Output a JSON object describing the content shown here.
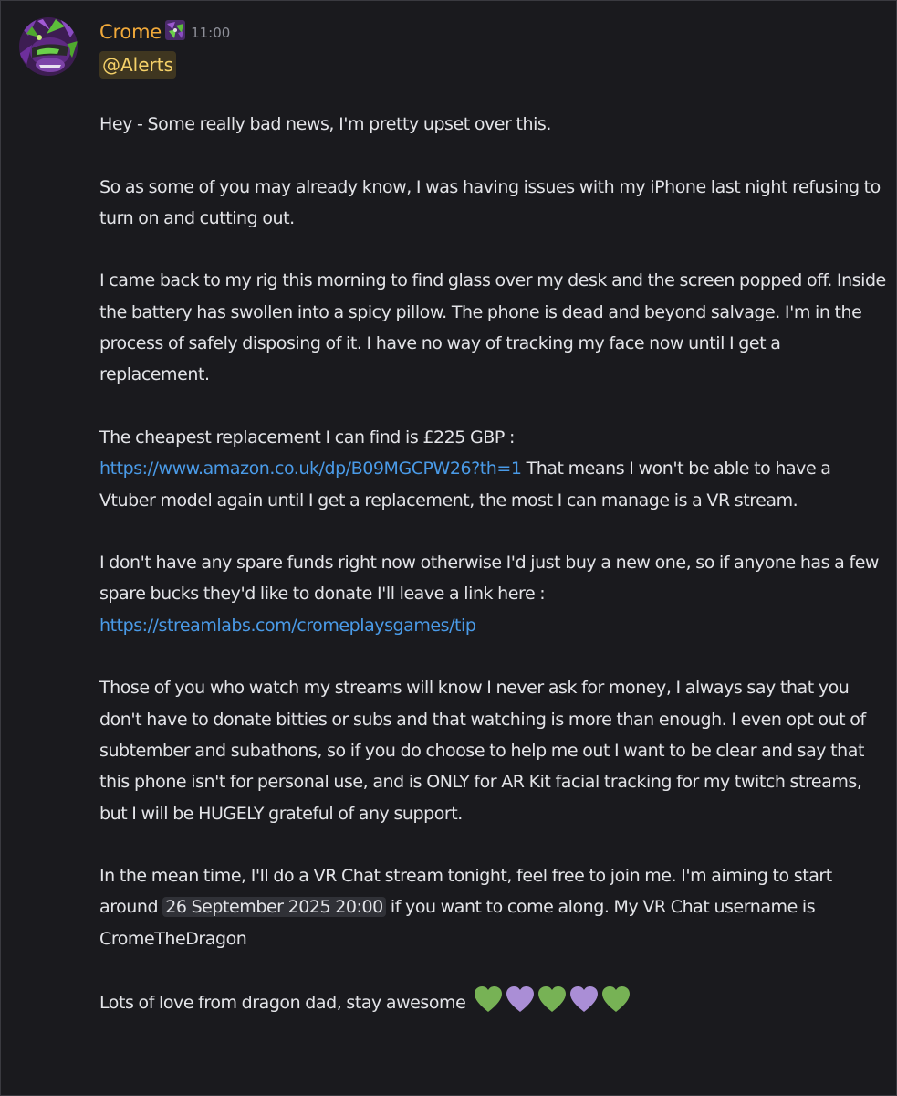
{
  "message": {
    "author": "Crome",
    "timestamp": "11:00",
    "mention": "@Alerts",
    "paragraphs": {
      "p1": "Hey - Some really bad news, I'm pretty upset over this.",
      "p2": "So as some of you may already know, I was having issues with my iPhone last night refusing to turn on and cutting out.",
      "p3": "I came back to my rig this morning to find glass over my desk and the screen popped off. Inside the battery has swollen into a spicy pillow. The phone is dead and beyond salvage. I'm in the process of safely disposing of it. I have no way of tracking my face now until I get a replacement.",
      "p4_text": "The cheapest replacement I can find  is £225 GBP :",
      "p4_link": "https://www.amazon.co.uk/dp/B09MGCPW26?th=1",
      "p4_after": " That means I won't be able to have a Vtuber model again until I get a replacement, the most I can manage is a VR stream.",
      "p5_text": "I don't have any spare funds right now otherwise I'd just buy a new one, so if anyone has a few spare bucks they'd like to donate I'll leave a link here :",
      "p5_link": "https://streamlabs.com/cromeplaysgames/tip",
      "p6": "Those of you who watch my streams will know I never ask for money, I always say that you don't have to donate bitties or subs and that watching is more than enough. I even opt out of subtember and subathons, so if you do choose to help me out I want to be clear and say that this phone isn't for personal use, and is ONLY for AR Kit facial tracking for my twitch streams, but I will be HUGELY grateful of any support.",
      "p7_before": "In the mean time, I'll do a VR Chat stream tonight, feel free to join me. I'm aiming to start around ",
      "p7_time": "26 September 2025 20:00",
      "p7_after": " if you want to come along. My VR Chat username is CromeTheDragon",
      "p8": "Lots of love from dragon dad, stay awesome "
    },
    "hearts": [
      "green-heart",
      "purple-heart",
      "green-heart",
      "purple-heart",
      "green-heart"
    ]
  },
  "colors": {
    "background": "#1a1a1e",
    "username": "#f1a93a",
    "mention_bg": "#3f3620",
    "mention_text": "#f5d169",
    "link": "#4a9be8",
    "text": "#e3e4e8",
    "green_heart": "#77b255",
    "purple_heart": "#aa8ed6"
  }
}
